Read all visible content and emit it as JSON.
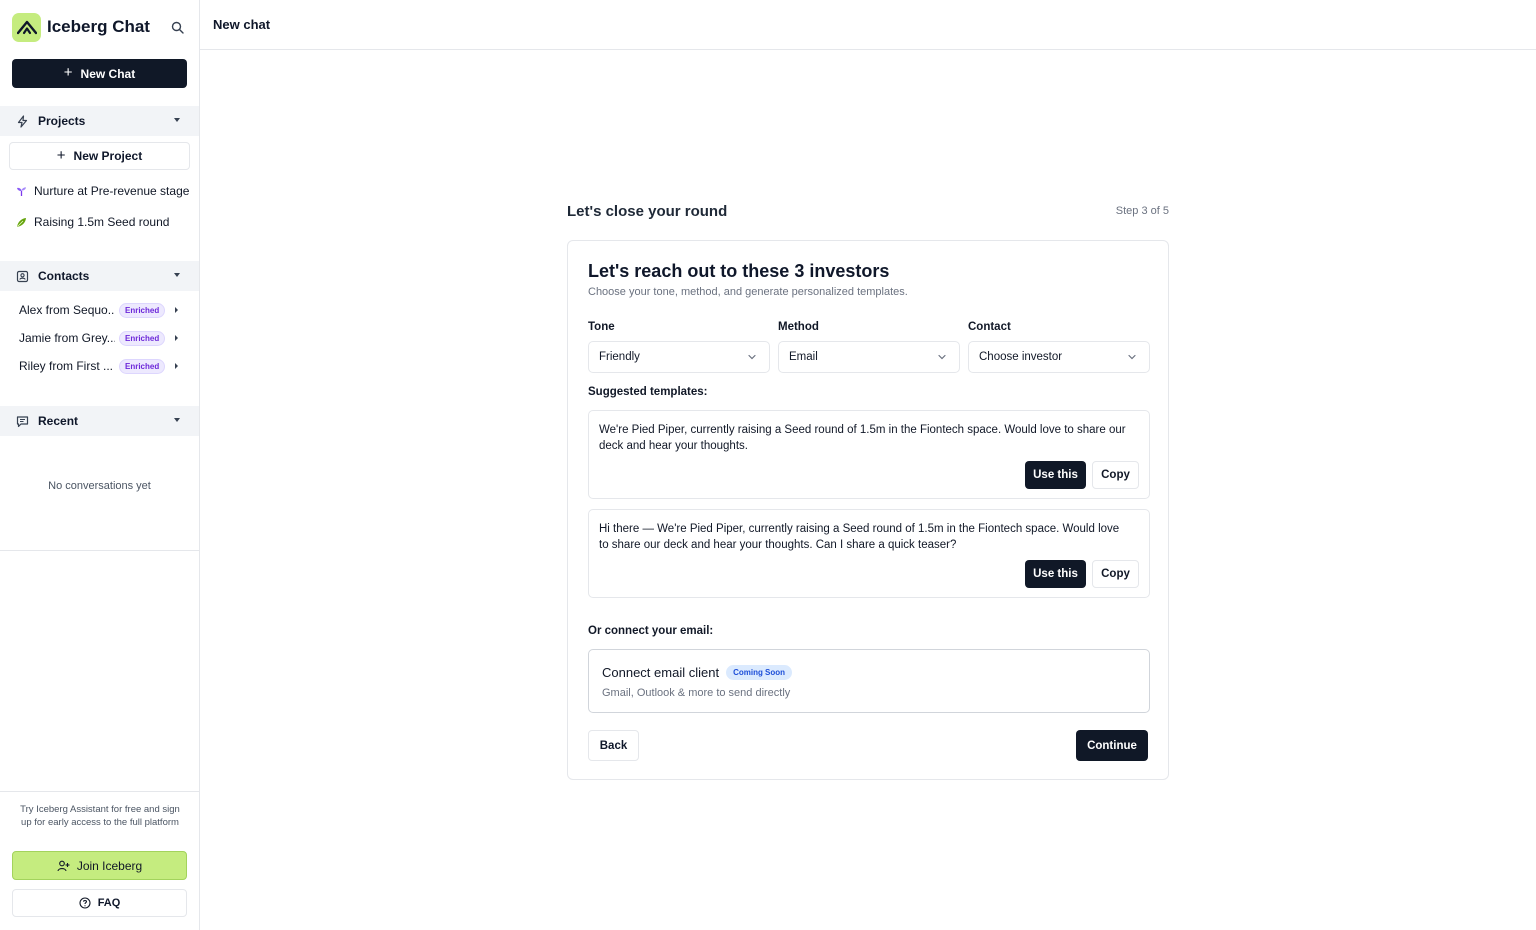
{
  "app": {
    "title": "Iceberg Chat",
    "logo_icon": "mountain-logo-icon",
    "accent_color": "#c5ec7f",
    "primary_color": "#101827"
  },
  "sidebar": {
    "new_chat_label": "New Chat",
    "projects": {
      "label": "Projects",
      "new_project_label": "New Project",
      "items": [
        {
          "label": "Nurture at Pre-revenue stage",
          "icon": "seedling-icon"
        },
        {
          "label": "Raising 1.5m Seed round",
          "icon": "leaf-icon"
        }
      ]
    },
    "contacts": {
      "label": "Contacts",
      "items": [
        {
          "name": "Alex from Sequo...",
          "badge": "Enriched"
        },
        {
          "name": "Jamie from Grey...",
          "badge": "Enriched"
        },
        {
          "name": "Riley from First ...",
          "badge": "Enriched"
        }
      ]
    },
    "recent": {
      "label": "Recent",
      "empty_text": "No conversations yet"
    },
    "promo_text": "Try Iceberg Assistant for free and sign up for early access to the full platform",
    "join_label": "Join Iceberg",
    "faq_label": "FAQ"
  },
  "header": {
    "title": "New chat"
  },
  "main": {
    "heading": "Let's close your round",
    "step": "Step 3 of 5",
    "card": {
      "title": "Let's reach out to these 3 investors",
      "subtitle": "Choose your tone, method, and generate personalized templates.",
      "fields": [
        {
          "label": "Tone",
          "value": "Friendly"
        },
        {
          "label": "Method",
          "value": "Email"
        },
        {
          "label": "Contact",
          "value": "Choose investor"
        }
      ],
      "suggested_label": "Suggested templates:",
      "templates": [
        {
          "text": "We're Pied Piper, currently raising a Seed round of 1.5m in the Fiontech space. Would love to share our deck and hear your thoughts.",
          "use_label": "Use this",
          "copy_label": "Copy"
        },
        {
          "text": "Hi there — We're Pied Piper, currently raising a Seed round of 1.5m in the Fiontech space. Would love to share our deck and hear your thoughts. Can I share a quick teaser?",
          "use_label": "Use this",
          "copy_label": "Copy"
        }
      ],
      "connect_label": "Or connect your email:",
      "connect_title": "Connect email client",
      "connect_badge": "Coming Soon",
      "connect_sub": "Gmail, Outlook & more to send directly",
      "back_label": "Back",
      "continue_label": "Continue"
    }
  }
}
